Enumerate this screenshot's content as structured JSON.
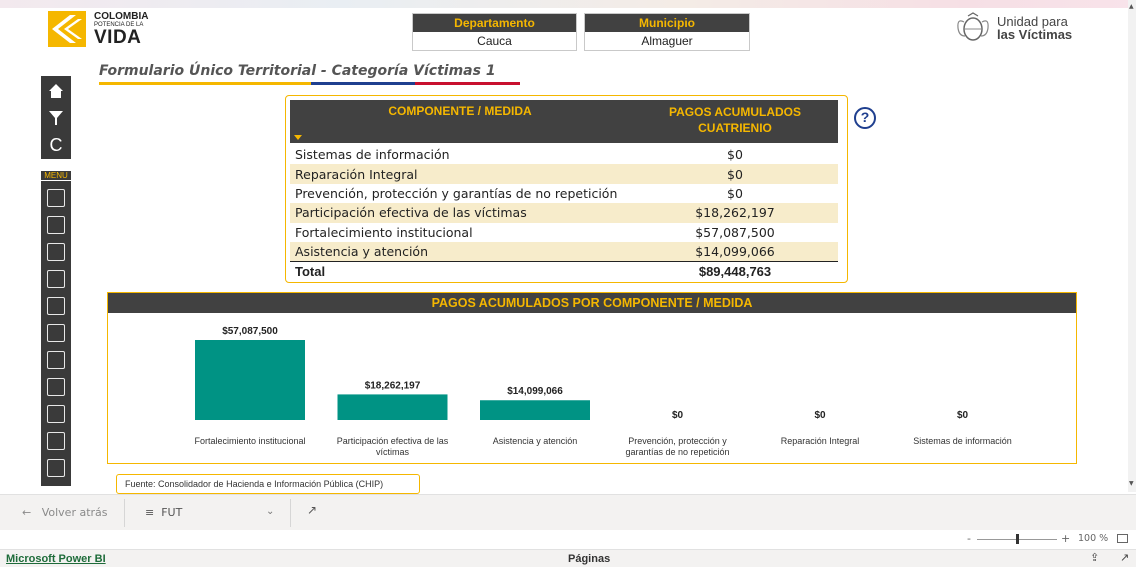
{
  "header": {
    "logo": {
      "line1": "COLOMBIA",
      "line2": "POTENCIA DE LA",
      "line3": "VIDA"
    },
    "departamento": {
      "label": "Departamento",
      "value": "Cauca"
    },
    "municipio": {
      "label": "Municipio",
      "value": "Almaguer"
    },
    "unidad": {
      "line1": "Unidad para",
      "line2": "las Víctimas"
    }
  },
  "form_title": "Formulario Único Territorial - Categoría Víctimas 1",
  "sidenav": {
    "menu_label": "MENU",
    "top_icons": [
      "home-icon",
      "filter-icon",
      "reset-icon"
    ],
    "items": [
      "map-icon",
      "people-icon",
      "ruv-doc-icon",
      "bar-chart-icon",
      "column-chart-icon",
      "municipal-map-icon",
      "report-icon",
      "population-icon",
      "hands-icon",
      "table-icon",
      "doc-export-icon"
    ]
  },
  "table": {
    "col1": "COMPONENTE / MEDIDA",
    "col2": "PAGOS ACUMULADOS CUATRIENIO",
    "rows": [
      {
        "name": "Sistemas de información",
        "value": "$0"
      },
      {
        "name": "Reparación Integral",
        "value": "$0"
      },
      {
        "name": "Prevención, protección y garantías de no repetición",
        "value": "$0"
      },
      {
        "name": "Participación efectiva de las víctimas",
        "value": "$18,262,197"
      },
      {
        "name": "Fortalecimiento institucional",
        "value": "$57,087,500"
      },
      {
        "name": "Asistencia y atención",
        "value": "$14,099,066"
      }
    ],
    "total_label": "Total",
    "total_value": "$89,448,763",
    "help_glyph": "?"
  },
  "chart_title": "PAGOS ACUMULADOS POR COMPONENTE / MEDIDA",
  "chart_data": {
    "type": "bar",
    "title": "PAGOS ACUMULADOS POR COMPONENTE / MEDIDA",
    "categories": [
      "Fortalecimiento institucional",
      "Participación efectiva de las víctimas",
      "Asistencia y atención",
      "Prevención, protección y garantías de no repetición",
      "Reparación Integral",
      "Sistemas de información"
    ],
    "category_lines": [
      [
        "Fortalecimiento institucional"
      ],
      [
        "Participación efectiva de las",
        "víctimas"
      ],
      [
        "Asistencia y atención"
      ],
      [
        "Prevención, protección y",
        "garantías de no repetición"
      ],
      [
        "Reparación Integral"
      ],
      [
        "Sistemas de información"
      ]
    ],
    "values": [
      57087500,
      18262197,
      14099066,
      0,
      0,
      0
    ],
    "labels": [
      "$57,087,500",
      "$18,262,197",
      "$14,099,066",
      "$0",
      "$0",
      "$0"
    ],
    "bar_color": "#009384",
    "ylim": [
      0,
      57087500
    ],
    "grid": false
  },
  "source": "Fuente: Consolidador de Hacienda e Información Pública (CHIP)",
  "bottom_nav": {
    "back_label": "Volver atrás",
    "page_label": "FUT"
  },
  "zoom": {
    "percent": "100 %",
    "level": 0.5
  },
  "footer": {
    "brand": "Microsoft Power BI",
    "pages": "Páginas"
  },
  "colors": {
    "accent": "#F5B700",
    "header_bg": "#414141",
    "bar": "#009384",
    "alt_row": "#F7ECCB"
  }
}
